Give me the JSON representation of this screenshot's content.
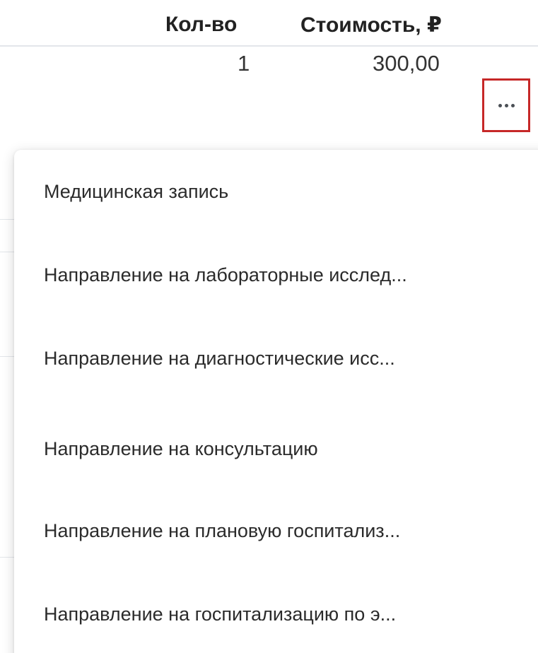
{
  "table": {
    "headers": {
      "quantity": "Кол-во",
      "cost": "Стоимость, ₽"
    },
    "rows": [
      {
        "quantity": "1",
        "cost": "300,00"
      }
    ]
  },
  "row_actions": {
    "more_icon": "more-horizontal-icon",
    "highlight_color": "#c62828"
  },
  "menu": {
    "items": [
      {
        "label": "Медицинская запись"
      },
      {
        "label": "Направление на лабораторные исслед..."
      },
      {
        "label": "Направление на диагностические исс..."
      },
      {
        "label": "Направление на консультацию"
      },
      {
        "label": "Направление на плановую госпитализ..."
      },
      {
        "label": "Направление на госпитализацию по э..."
      }
    ]
  }
}
